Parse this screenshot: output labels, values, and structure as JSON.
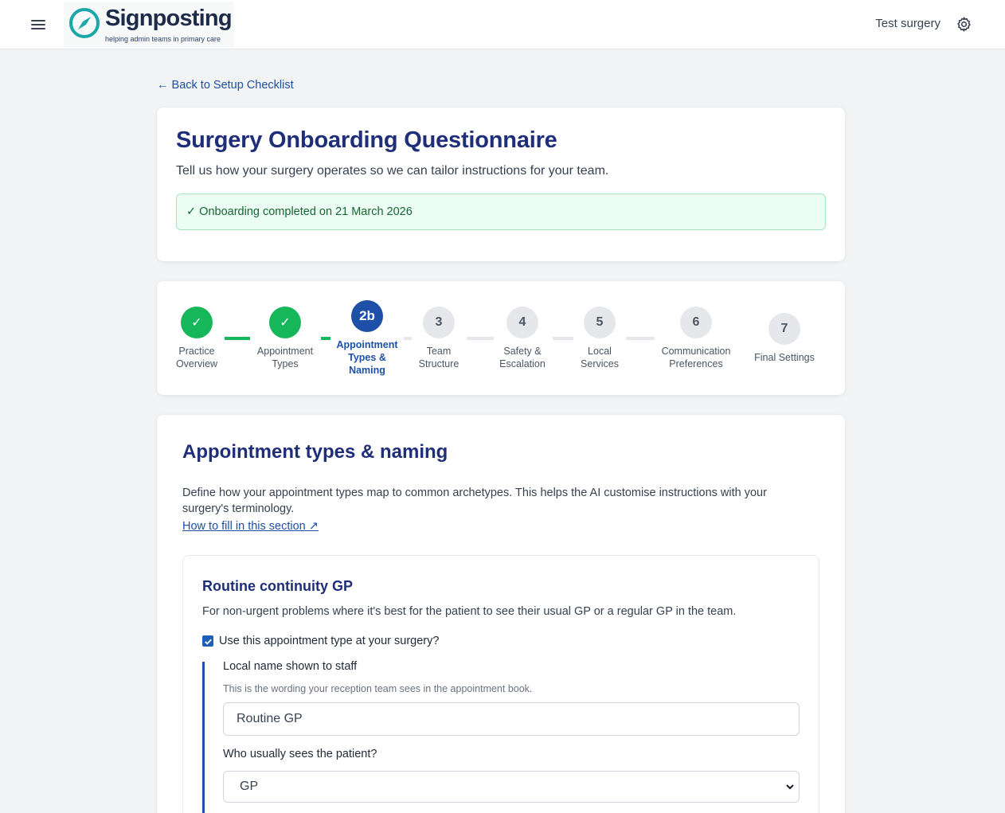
{
  "header": {
    "logo_title": "Signposting",
    "logo_tagline": "helping admin teams in primary care",
    "surgery_name": "Test surgery"
  },
  "back_link": "← Back to Setup Checklist",
  "intro": {
    "title": "Surgery Onboarding Questionnaire",
    "subtitle": "Tell us how your surgery operates so we can tailor instructions for your team.",
    "status": "✓ Onboarding completed on 21 March 2026"
  },
  "steps": [
    {
      "marker": "✓",
      "label": "Practice\nOverview",
      "state": "done"
    },
    {
      "marker": "✓",
      "label": "Appointment\nTypes",
      "state": "done"
    },
    {
      "marker": "2b",
      "label": "Appointment\nTypes &\nNaming",
      "state": "current"
    },
    {
      "marker": "3",
      "label": "Team\nStructure",
      "state": "todo"
    },
    {
      "marker": "4",
      "label": "Safety &\nEscalation",
      "state": "todo"
    },
    {
      "marker": "5",
      "label": "Local\nServices",
      "state": "todo"
    },
    {
      "marker": "6",
      "label": "Communication\nPreferences",
      "state": "todo"
    },
    {
      "marker": "7",
      "label": "Final Settings",
      "state": "todo"
    }
  ],
  "colors": {
    "done": "#16b65a",
    "current": "#1e50a8",
    "todo": "#e5e7eb",
    "heading": "#1e2e78"
  },
  "section": {
    "title": "Appointment types & naming",
    "description": "Define how your appointment types map to common archetypes. This helps the AI customise instructions with your surgery's terminology.",
    "help_link": "How to fill in this section ↗"
  },
  "appointment_type": {
    "title": "Routine continuity GP",
    "description": "For non-urgent problems where it's best for the patient to see their usual GP or a regular GP in the team.",
    "use_label": "Use this appointment type at your surgery?",
    "use_checked": true,
    "local_name_label": "Local name shown to staff",
    "local_name_help": "This is the wording your reception team sees in the appointment book.",
    "local_name_value": "Routine GP",
    "who_sees_label": "Who usually sees the patient?",
    "who_sees_value": "GP"
  }
}
